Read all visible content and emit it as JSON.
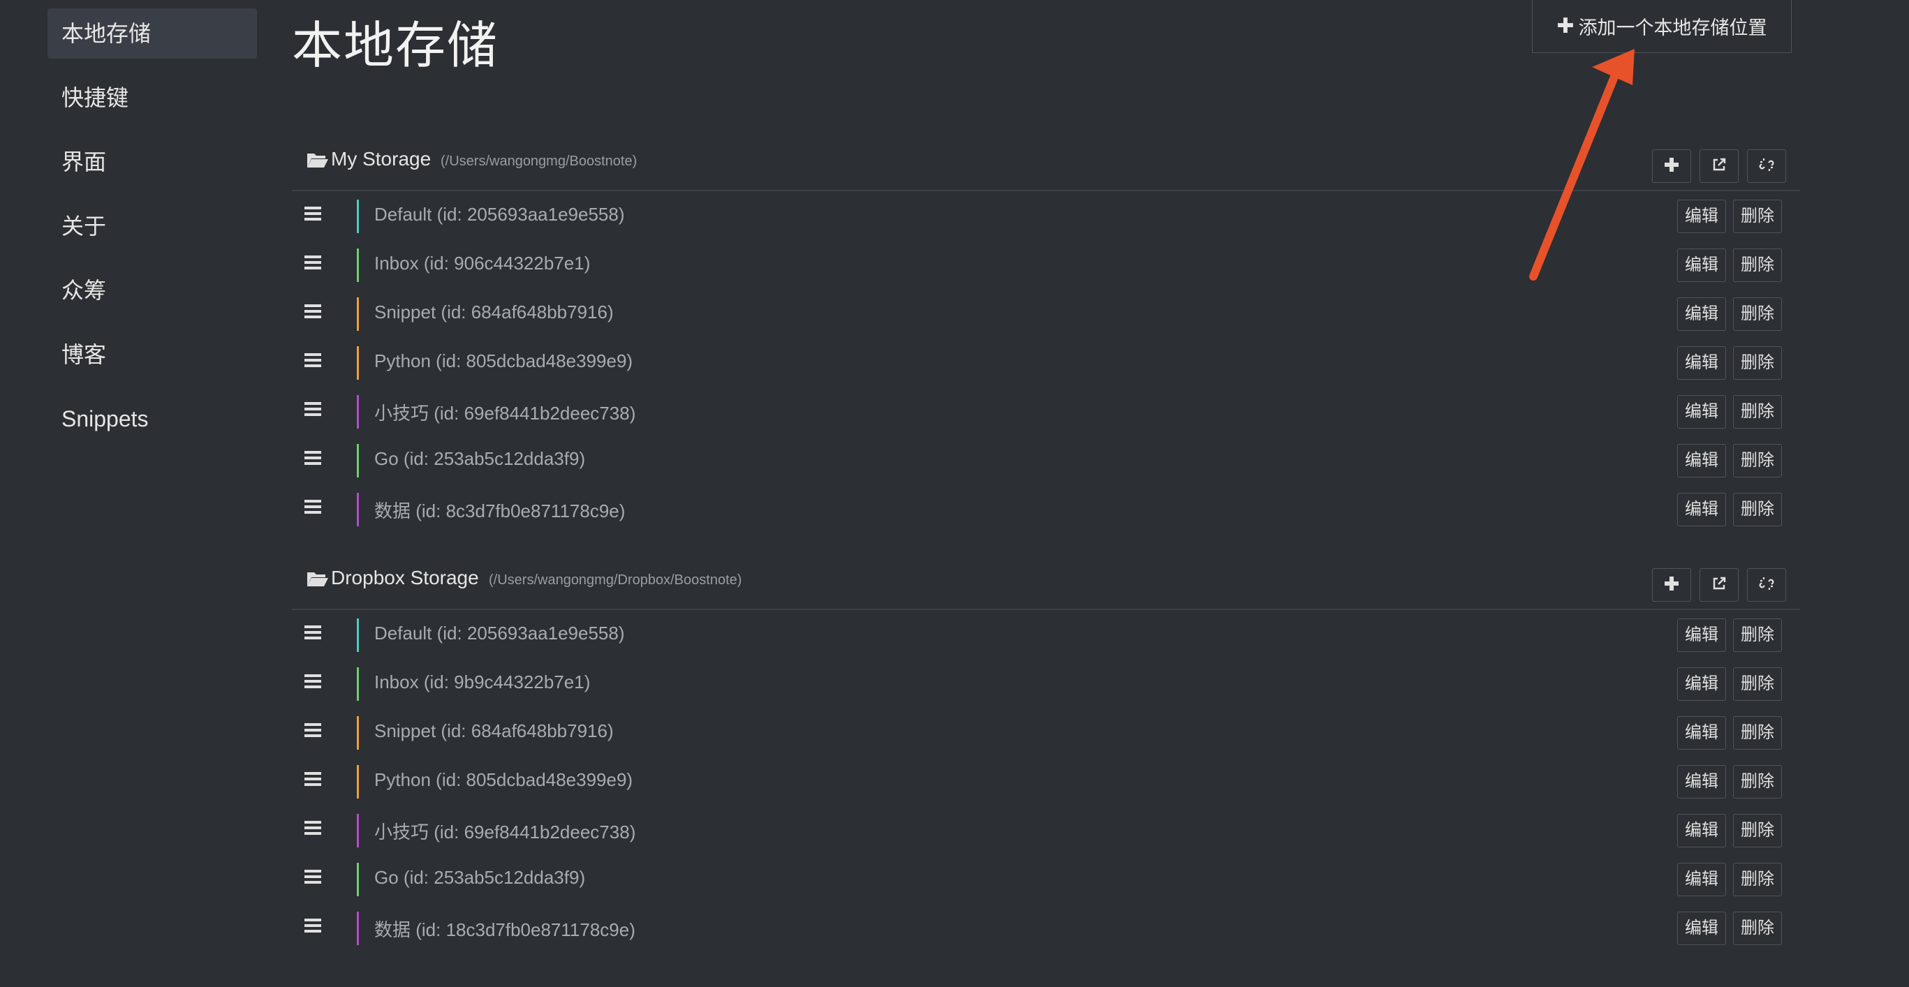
{
  "sidebar": {
    "items": [
      {
        "label": "本地存储",
        "active": true
      },
      {
        "label": "快捷键"
      },
      {
        "label": "界面"
      },
      {
        "label": "关于"
      },
      {
        "label": "众筹"
      },
      {
        "label": "博客"
      },
      {
        "label": "Snippets"
      }
    ]
  },
  "main": {
    "title": "本地存储",
    "add_storage_label": "添加一个本地存储位置",
    "add_icon": "plus-icon"
  },
  "storages": [
    {
      "name": "My Storage",
      "path": "(/Users/wangongmg/Boostnote)",
      "folders": [
        {
          "label": "Default (id: 205693aa1e9e558)",
          "color": "#4ecdc4"
        },
        {
          "label": "Inbox (id: 906c44322b7e1)",
          "color": "#6fcf6f"
        },
        {
          "label": "Snippet (id: 684af648bb7916)",
          "color": "#f0a03c"
        },
        {
          "label": "Python (id: 805dcbad48e399e9)",
          "color": "#f0a03c"
        },
        {
          "label": "小技巧 (id: 69ef8441b2deec738)",
          "color": "#b04fcf"
        },
        {
          "label": "Go (id: 253ab5c12dda3f9)",
          "color": "#6fcf6f"
        },
        {
          "label": "数据 (id: 8c3d7fb0e871178c9e)",
          "color": "#b04fcf"
        }
      ]
    },
    {
      "name": "Dropbox Storage",
      "path": "(/Users/wangongmg/Dropbox/Boostnote)",
      "folders": [
        {
          "label": "Default (id: 205693aa1e9e558)",
          "color": "#4ecdc4"
        },
        {
          "label": "Inbox (id: 9b9c44322b7e1)",
          "color": "#6fcf6f"
        },
        {
          "label": "Snippet (id: 684af648bb7916)",
          "color": "#f0a03c"
        },
        {
          "label": "Python (id: 805dcbad48e399e9)",
          "color": "#f0a03c"
        },
        {
          "label": "小技巧 (id: 69ef8441b2deec738)",
          "color": "#b04fcf"
        },
        {
          "label": "Go (id: 253ab5c12dda3f9)",
          "color": "#6fcf6f"
        },
        {
          "label": "数据 (id: 18c3d7fb0e871178c9e)",
          "color": "#b04fcf"
        }
      ]
    }
  ],
  "row_actions": {
    "edit": "编辑",
    "delete": "删除"
  },
  "head_action_icons": [
    "plus-icon",
    "external-link-icon",
    "unlink-icon"
  ],
  "colors": {
    "background": "#2c2f33",
    "arrow": "#e8522a",
    "active_item": "#3a3e47"
  }
}
